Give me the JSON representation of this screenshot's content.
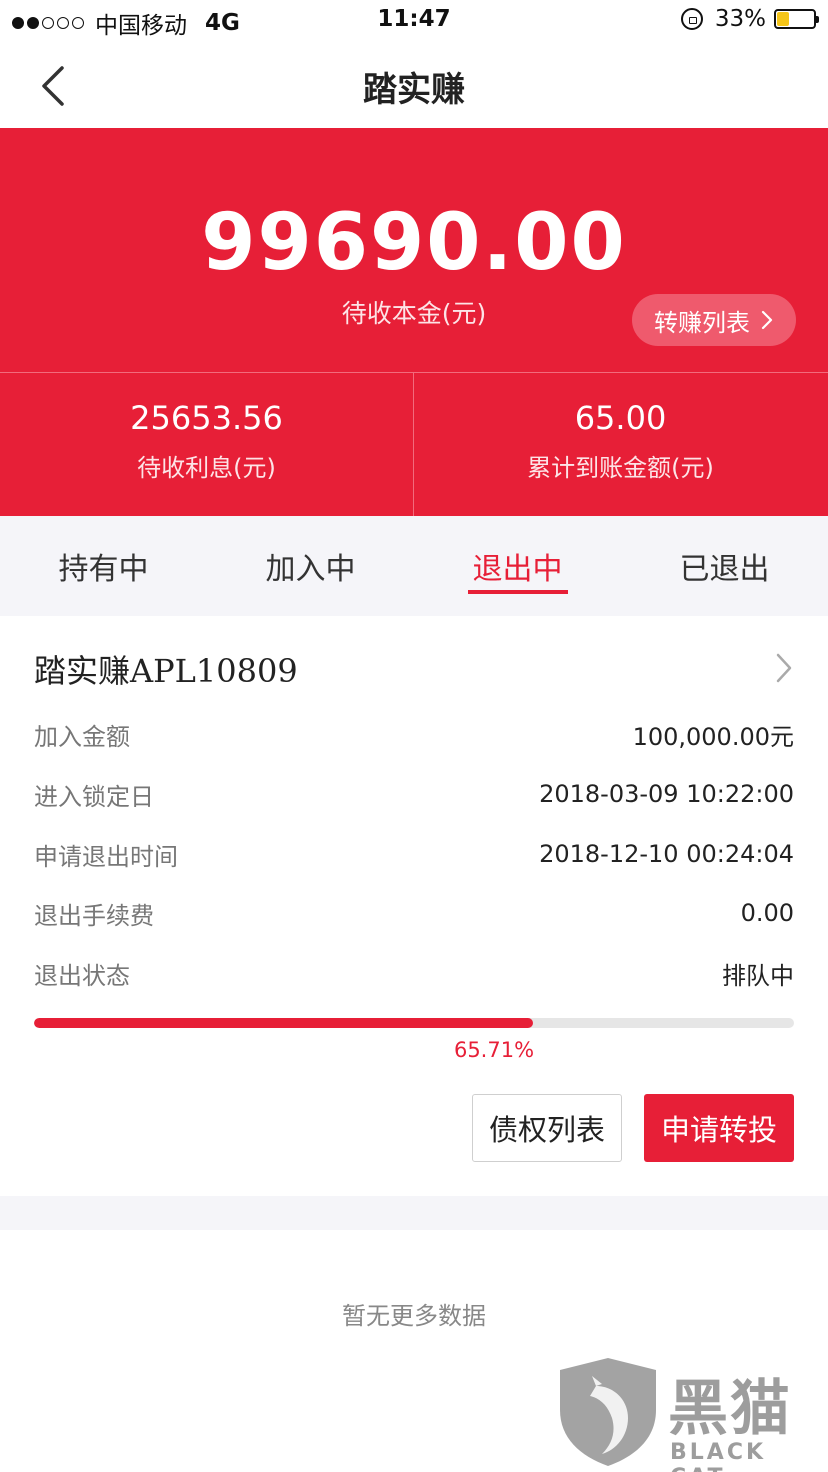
{
  "status_bar": {
    "carrier": "中国移动",
    "network": "4G",
    "time": "11:47",
    "battery_pct_label": "33%",
    "battery_level": 0.33
  },
  "nav": {
    "title": "踏实赚"
  },
  "summary": {
    "principal_amount": "99690.00",
    "principal_label": "待收本金(元)",
    "transfer_list_label": "转赚列表",
    "interest_value": "25653.56",
    "interest_label": "待收利息(元)",
    "received_value": "65.00",
    "received_label": "累计到账金额(元)"
  },
  "tabs": [
    {
      "label": "持有中",
      "active": false
    },
    {
      "label": "加入中",
      "active": false
    },
    {
      "label": "退出中",
      "active": true
    },
    {
      "label": "已退出",
      "active": false
    }
  ],
  "card": {
    "title": "踏实赚APL10809",
    "rows": [
      {
        "label": "加入金额",
        "value": "100,000.00元"
      },
      {
        "label": "进入锁定日",
        "value": "2018-03-09 10:22:00"
      },
      {
        "label": "申请退出时间",
        "value": "2018-12-10 00:24:04"
      },
      {
        "label": "退出手续费",
        "value": "0.00"
      },
      {
        "label": "退出状态",
        "value": "排队中"
      }
    ],
    "progress_fraction": 0.6571,
    "progress_label": "65.71%",
    "debt_list_button": "债权列表",
    "apply_transfer_button": "申请转投"
  },
  "footer": {
    "no_more_label": "暂无更多数据"
  },
  "watermark": {
    "cn": "黑猫",
    "en": "BLACK CAT"
  },
  "colors": {
    "brand_red": "#e71f37",
    "battery_yellow": "#f5c518"
  }
}
